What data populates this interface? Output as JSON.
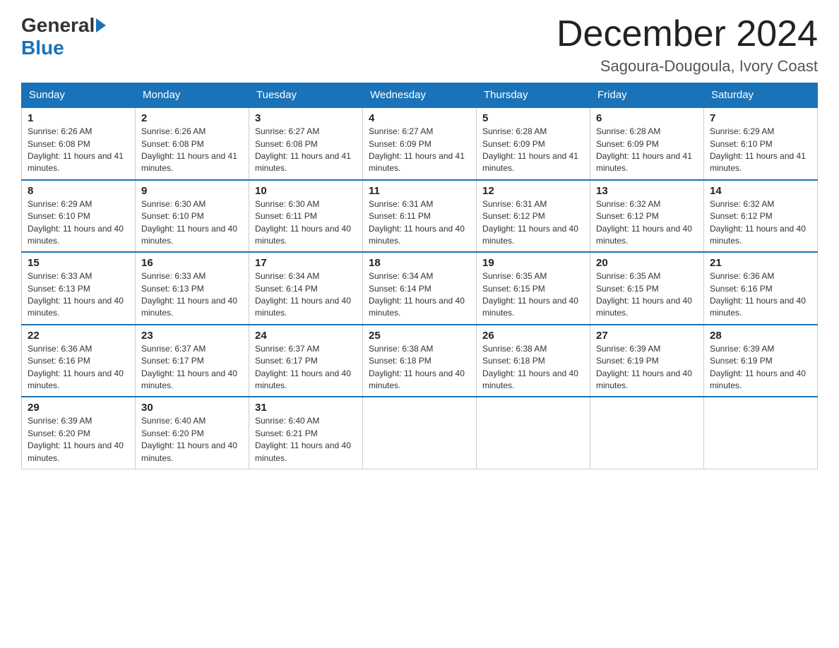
{
  "header": {
    "logo_general": "General",
    "logo_blue": "Blue",
    "main_title": "December 2024",
    "subtitle": "Sagoura-Dougoula, Ivory Coast"
  },
  "calendar": {
    "days_of_week": [
      "Sunday",
      "Monday",
      "Tuesday",
      "Wednesday",
      "Thursday",
      "Friday",
      "Saturday"
    ],
    "weeks": [
      [
        {
          "day": "1",
          "sunrise": "6:26 AM",
          "sunset": "6:08 PM",
          "daylight": "11 hours and 41 minutes."
        },
        {
          "day": "2",
          "sunrise": "6:26 AM",
          "sunset": "6:08 PM",
          "daylight": "11 hours and 41 minutes."
        },
        {
          "day": "3",
          "sunrise": "6:27 AM",
          "sunset": "6:08 PM",
          "daylight": "11 hours and 41 minutes."
        },
        {
          "day": "4",
          "sunrise": "6:27 AM",
          "sunset": "6:09 PM",
          "daylight": "11 hours and 41 minutes."
        },
        {
          "day": "5",
          "sunrise": "6:28 AM",
          "sunset": "6:09 PM",
          "daylight": "11 hours and 41 minutes."
        },
        {
          "day": "6",
          "sunrise": "6:28 AM",
          "sunset": "6:09 PM",
          "daylight": "11 hours and 41 minutes."
        },
        {
          "day": "7",
          "sunrise": "6:29 AM",
          "sunset": "6:10 PM",
          "daylight": "11 hours and 41 minutes."
        }
      ],
      [
        {
          "day": "8",
          "sunrise": "6:29 AM",
          "sunset": "6:10 PM",
          "daylight": "11 hours and 40 minutes."
        },
        {
          "day": "9",
          "sunrise": "6:30 AM",
          "sunset": "6:10 PM",
          "daylight": "11 hours and 40 minutes."
        },
        {
          "day": "10",
          "sunrise": "6:30 AM",
          "sunset": "6:11 PM",
          "daylight": "11 hours and 40 minutes."
        },
        {
          "day": "11",
          "sunrise": "6:31 AM",
          "sunset": "6:11 PM",
          "daylight": "11 hours and 40 minutes."
        },
        {
          "day": "12",
          "sunrise": "6:31 AM",
          "sunset": "6:12 PM",
          "daylight": "11 hours and 40 minutes."
        },
        {
          "day": "13",
          "sunrise": "6:32 AM",
          "sunset": "6:12 PM",
          "daylight": "11 hours and 40 minutes."
        },
        {
          "day": "14",
          "sunrise": "6:32 AM",
          "sunset": "6:12 PM",
          "daylight": "11 hours and 40 minutes."
        }
      ],
      [
        {
          "day": "15",
          "sunrise": "6:33 AM",
          "sunset": "6:13 PM",
          "daylight": "11 hours and 40 minutes."
        },
        {
          "day": "16",
          "sunrise": "6:33 AM",
          "sunset": "6:13 PM",
          "daylight": "11 hours and 40 minutes."
        },
        {
          "day": "17",
          "sunrise": "6:34 AM",
          "sunset": "6:14 PM",
          "daylight": "11 hours and 40 minutes."
        },
        {
          "day": "18",
          "sunrise": "6:34 AM",
          "sunset": "6:14 PM",
          "daylight": "11 hours and 40 minutes."
        },
        {
          "day": "19",
          "sunrise": "6:35 AM",
          "sunset": "6:15 PM",
          "daylight": "11 hours and 40 minutes."
        },
        {
          "day": "20",
          "sunrise": "6:35 AM",
          "sunset": "6:15 PM",
          "daylight": "11 hours and 40 minutes."
        },
        {
          "day": "21",
          "sunrise": "6:36 AM",
          "sunset": "6:16 PM",
          "daylight": "11 hours and 40 minutes."
        }
      ],
      [
        {
          "day": "22",
          "sunrise": "6:36 AM",
          "sunset": "6:16 PM",
          "daylight": "11 hours and 40 minutes."
        },
        {
          "day": "23",
          "sunrise": "6:37 AM",
          "sunset": "6:17 PM",
          "daylight": "11 hours and 40 minutes."
        },
        {
          "day": "24",
          "sunrise": "6:37 AM",
          "sunset": "6:17 PM",
          "daylight": "11 hours and 40 minutes."
        },
        {
          "day": "25",
          "sunrise": "6:38 AM",
          "sunset": "6:18 PM",
          "daylight": "11 hours and 40 minutes."
        },
        {
          "day": "26",
          "sunrise": "6:38 AM",
          "sunset": "6:18 PM",
          "daylight": "11 hours and 40 minutes."
        },
        {
          "day": "27",
          "sunrise": "6:39 AM",
          "sunset": "6:19 PM",
          "daylight": "11 hours and 40 minutes."
        },
        {
          "day": "28",
          "sunrise": "6:39 AM",
          "sunset": "6:19 PM",
          "daylight": "11 hours and 40 minutes."
        }
      ],
      [
        {
          "day": "29",
          "sunrise": "6:39 AM",
          "sunset": "6:20 PM",
          "daylight": "11 hours and 40 minutes."
        },
        {
          "day": "30",
          "sunrise": "6:40 AM",
          "sunset": "6:20 PM",
          "daylight": "11 hours and 40 minutes."
        },
        {
          "day": "31",
          "sunrise": "6:40 AM",
          "sunset": "6:21 PM",
          "daylight": "11 hours and 40 minutes."
        },
        null,
        null,
        null,
        null
      ]
    ]
  }
}
